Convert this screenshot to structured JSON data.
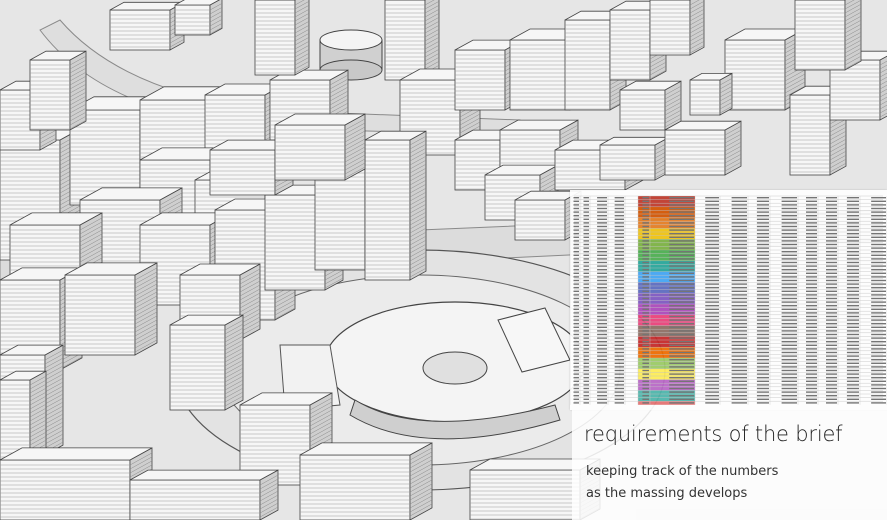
{
  "caption": {
    "title": "requirements of the brief",
    "subtitle_line1": "keeping track of the numbers",
    "subtitle_line2": "as the massing develops"
  },
  "colors": {
    "ground": "#e6e6e6",
    "building_light": "#f6f6f6",
    "building_shade": "#cfcfcf",
    "line": "#444444",
    "sheet_bands": [
      "#c0392b",
      "#d35400",
      "#e67e22",
      "#f1c40f",
      "#7cb342",
      "#4caf50",
      "#26a69a",
      "#42a5f5",
      "#5c6bc0",
      "#7e57c2",
      "#ab47bc",
      "#ec407a",
      "#8d6e63",
      "#c62828",
      "#ef6c00",
      "#9ccc65",
      "#ffee58",
      "#ba68c8",
      "#4db6ac",
      "#e57373"
    ]
  },
  "icons": {
    "spreadsheet": "spreadsheet-table-icon"
  }
}
